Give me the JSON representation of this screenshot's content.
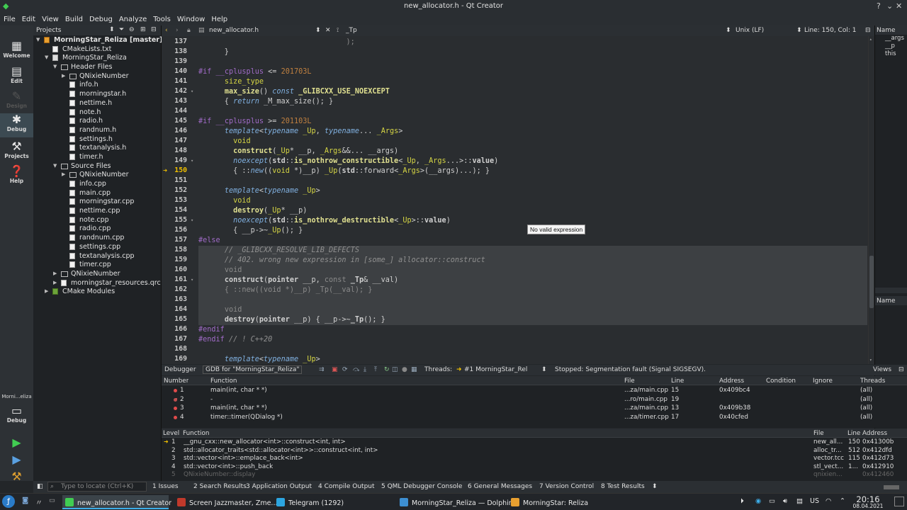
{
  "window": {
    "title": "new_allocator.h - Qt Creator"
  },
  "menu": [
    "File",
    "Edit",
    "View",
    "Build",
    "Debug",
    "Analyze",
    "Tools",
    "Window",
    "Help"
  ],
  "modes": [
    {
      "label": "Welcome",
      "icon": "grid-icon"
    },
    {
      "label": "Edit",
      "icon": "document-icon"
    },
    {
      "label": "Design",
      "icon": "pencil-icon",
      "disabled": true
    },
    {
      "label": "Debug",
      "icon": "bug-icon",
      "active": true
    },
    {
      "label": "Projects",
      "icon": "wrench-icon"
    },
    {
      "label": "Help",
      "icon": "help-icon"
    }
  ],
  "kit": {
    "project": "Morni...eliza",
    "mode": "Debug"
  },
  "projects": {
    "header": "Projects",
    "tree": [
      {
        "label": "MorningStar_Reliza [master]",
        "depth": 0,
        "arrow": "open",
        "icon": "project",
        "bold": true
      },
      {
        "label": "CMakeLists.txt",
        "depth": 1,
        "icon": "file"
      },
      {
        "label": "MorningStar_Reliza",
        "depth": 1,
        "arrow": "open",
        "icon": "target"
      },
      {
        "label": "Header Files",
        "depth": 2,
        "arrow": "open",
        "icon": "folder"
      },
      {
        "label": "QNixieNumber",
        "depth": 3,
        "arrow": "closed",
        "icon": "folder"
      },
      {
        "label": "info.h",
        "depth": 3,
        "icon": "file"
      },
      {
        "label": "morningstar.h",
        "depth": 3,
        "icon": "file"
      },
      {
        "label": "nettime.h",
        "depth": 3,
        "icon": "file"
      },
      {
        "label": "note.h",
        "depth": 3,
        "icon": "file"
      },
      {
        "label": "radio.h",
        "depth": 3,
        "icon": "file"
      },
      {
        "label": "randnum.h",
        "depth": 3,
        "icon": "file"
      },
      {
        "label": "settings.h",
        "depth": 3,
        "icon": "file"
      },
      {
        "label": "textanalysis.h",
        "depth": 3,
        "icon": "file"
      },
      {
        "label": "timer.h",
        "depth": 3,
        "icon": "file"
      },
      {
        "label": "Source Files",
        "depth": 2,
        "arrow": "open",
        "icon": "folder"
      },
      {
        "label": "QNixieNumber",
        "depth": 3,
        "arrow": "closed",
        "icon": "folder"
      },
      {
        "label": "info.cpp",
        "depth": 3,
        "icon": "file"
      },
      {
        "label": "main.cpp",
        "depth": 3,
        "icon": "file"
      },
      {
        "label": "morningstar.cpp",
        "depth": 3,
        "icon": "file"
      },
      {
        "label": "nettime.cpp",
        "depth": 3,
        "icon": "file"
      },
      {
        "label": "note.cpp",
        "depth": 3,
        "icon": "file"
      },
      {
        "label": "radio.cpp",
        "depth": 3,
        "icon": "file"
      },
      {
        "label": "randnum.cpp",
        "depth": 3,
        "icon": "file"
      },
      {
        "label": "settings.cpp",
        "depth": 3,
        "icon": "file"
      },
      {
        "label": "textanalysis.cpp",
        "depth": 3,
        "icon": "file"
      },
      {
        "label": "timer.cpp",
        "depth": 3,
        "icon": "file"
      },
      {
        "label": "QNixieNumber",
        "depth": 2,
        "arrow": "closed",
        "icon": "folder"
      },
      {
        "label": "morningstar_resources.qrc",
        "depth": 2,
        "arrow": "closed",
        "icon": "file"
      },
      {
        "label": "CMake Modules",
        "depth": 1,
        "arrow": "closed",
        "icon": "cmake"
      }
    ]
  },
  "editor": {
    "file": "new_allocator.h",
    "symbol": "_Tp",
    "line_ending": "Unix (LF)",
    "position": "Line: 150, Col: 1",
    "current_line": 150,
    "tooltip": "No valid expression",
    "lines": [
      {
        "n": 137,
        "h": "<span class='gr'>                                  );</span>"
      },
      {
        "n": 138,
        "h": "      }"
      },
      {
        "n": 139,
        "h": ""
      },
      {
        "n": 140,
        "h": "<span class='pp'>#if</span> <span class='pp'>__cplusplus</span> <= <span class='num'>201703L</span>"
      },
      {
        "n": 141,
        "h": "      <span class='ty'>size_type</span>"
      },
      {
        "n": 142,
        "h": "      <span class='fn'>max_size</span>() <span class='it'>const</span> <span class='fn'>_GLIBCXX_USE_NOEXCEPT</span>",
        "fold": 1
      },
      {
        "n": 143,
        "h": "      { <span class='it'>return</span> _M_max_size(); }"
      },
      {
        "n": 144,
        "h": ""
      },
      {
        "n": 145,
        "h": "<span class='pp'>#if</span> <span class='pp'>__cplusplus</span> >= <span class='num'>201103L</span>"
      },
      {
        "n": 146,
        "h": "      <span class='it'>template</span>&lt;<span class='it'>typename</span> <span class='ty'>_Up</span>, <span class='it'>typename</span>... <span class='ty'>_Args</span>&gt;"
      },
      {
        "n": 147,
        "h": "        <span class='ty'>void</span>"
      },
      {
        "n": 148,
        "h": "        <span class='fn'>construct</span>(<span class='ty'>_Up</span>* __p, <span class='ty'>_Args</span>&&... __args)"
      },
      {
        "n": 149,
        "h": "        <span class='it'>noexcept</span>(<span class='bo'>std</span>::<span class='fn'>is_nothrow_constructible</span>&lt;<span class='ty'>_Up</span>, <span class='ty'>_Args</span>...&gt;::<span class='bo'>value</span>)",
        "fold": 1
      },
      {
        "n": 150,
        "h": "        { ::<span class='it'>new</span>((<span class='ty'>void</span> *)__p) <span class='ty'>_Up</span>(<span class='bo'>std</span>::forward&lt;<span class='ty'>_Args</span>&gt;(__args)...); }"
      },
      {
        "n": 151,
        "h": ""
      },
      {
        "n": 152,
        "h": "      <span class='it'>template</span>&lt;<span class='it'>typename</span> <span class='ty'>_Up</span>&gt;"
      },
      {
        "n": 153,
        "h": "        <span class='ty'>void</span>"
      },
      {
        "n": 154,
        "h": "        <span class='fn'>destroy</span>(<span class='ty'>_Up</span>* __p)"
      },
      {
        "n": 155,
        "h": "        <span class='it'>noexcept</span>(<span class='bo'>std</span>::<span class='fn'>is_nothrow_destructible</span>&lt;<span class='ty'>_Up</span>&gt;::<span class='bo'>value</span>)",
        "fold": 1
      },
      {
        "n": 156,
        "h": "        { __p->~<span class='ty'>_Up</span>(); }"
      },
      {
        "n": 157,
        "h": "<span class='pp'>#else</span>"
      },
      {
        "n": 158,
        "h": "      <span class='cm'>// _GLIBCXX_RESOLVE_LIB_DEFECTS</span>",
        "hl": 1
      },
      {
        "n": 159,
        "h": "      <span class='cm'>// 402. wrong new expression in [some_] allocator::construct</span>",
        "hl": 1
      },
      {
        "n": 160,
        "h": "      <span class='gr'>void</span>",
        "hl": 1
      },
      {
        "n": 161,
        "h": "      <span class='bo'>construct</span>(<span class='bo'>pointer</span> __p, <span class='gr'>const</span> <span class='bo'>_Tp</span>& __val)",
        "hl": 1,
        "fold": 1
      },
      {
        "n": 162,
        "h": "      <span class='gr'>{ ::new((void *)__p) _Tp(__val); }</span>",
        "hl": 1
      },
      {
        "n": 163,
        "h": "",
        "hl": 1
      },
      {
        "n": 164,
        "h": "      <span class='gr'>void</span>",
        "hl": 1
      },
      {
        "n": 165,
        "h": "      <span class='bo'>destroy</span>(<span class='bo'>pointer</span> __p) { __p->~<span class='bo'>_Tp</span>(); }",
        "hl": 1
      },
      {
        "n": 166,
        "h": "<span class='pp'>#endif</span>"
      },
      {
        "n": 167,
        "h": "<span class='pp'>#endif</span> <span class='cm'>// ! C++20</span>"
      },
      {
        "n": 168,
        "h": ""
      },
      {
        "n": 169,
        "h": "      <span class='it'>template</span>&lt;<span class='it'>typename</span> <span class='ty'>_Up</span>&gt;"
      }
    ]
  },
  "locals": {
    "header": "Name",
    "items": [
      "__args",
      "__p",
      "this"
    ],
    "header2": "Name"
  },
  "debugger": {
    "label": "Debugger",
    "engine": "GDB for \"MorningStar_Reliza\"",
    "threads_label": "Threads:",
    "thread": "#1 MorningStar_Rel",
    "status": "Stopped: Segmentation fault (Signal SIGSEGV).",
    "views": "Views"
  },
  "breakpoints": {
    "columns": [
      "Number",
      "Function",
      "File",
      "Line",
      "Address",
      "Condition",
      "Ignore",
      "Threads"
    ],
    "rows": [
      {
        "num": "1",
        "func": "main(int, char * *)",
        "file": "...za/main.cpp",
        "line": "15",
        "addr": "0x409bc4",
        "thr": "(all)",
        "kind": "on"
      },
      {
        "num": "2",
        "func": "-",
        "file": "...ro/main.cpp",
        "line": "19",
        "addr": "",
        "thr": "(all)",
        "kind": "pending"
      },
      {
        "num": "3",
        "func": "main(int, char * *)",
        "file": "...za/main.cpp",
        "line": "13",
        "addr": "0x409b38",
        "thr": "(all)",
        "kind": "on"
      },
      {
        "num": "4",
        "func": "timer::timer(QDialog *)",
        "file": "...za/timer.cpp",
        "line": "17",
        "addr": "0x40cfed",
        "thr": "(all)",
        "kind": "on"
      }
    ]
  },
  "stack": {
    "columns": [
      "Level",
      "Function",
      "File",
      "Line",
      "Address"
    ],
    "rows": [
      {
        "lvl": "1",
        "func": "__gnu_cxx::new_allocator<int>::construct<int, int>",
        "file": "new_all...",
        "line": "150",
        "addr": "0x41300b",
        "cur": true
      },
      {
        "lvl": "2",
        "func": "std::allocator_traits<std::allocator<int>>::construct<int, int>",
        "file": "alloc_tr...",
        "line": "512",
        "addr": "0x412dfd"
      },
      {
        "lvl": "3",
        "func": "std::vector<int>::emplace_back<int>",
        "file": "vector.tcc",
        "line": "115",
        "addr": "0x412d73"
      },
      {
        "lvl": "4",
        "func": "std::vector<int>::push_back",
        "file": "stl_vect...",
        "line": "1...",
        "addr": "0x412910"
      },
      {
        "lvl": "5",
        "func": "QNixieNumber::display",
        "file": "qnixien...",
        "line": "",
        "addr": "0x412460",
        "dim": true
      }
    ]
  },
  "statusbar": {
    "locate_placeholder": "Type to locate (Ctrl+K)",
    "panes": [
      "1 Issues",
      "2 Search Results",
      "3 Application Output",
      "4 Compile Output",
      "5 QML Debugger Console",
      "6 General Messages",
      "7 Version Control",
      "8 Test Results"
    ]
  },
  "taskbar": {
    "tasks": [
      {
        "label": "new_allocator.h - Qt Creator",
        "active": true,
        "color": "#41cd52"
      },
      {
        "label": "Screen Jazzmaster, Zme...",
        "color": "#c0392b"
      },
      {
        "label": "Telegram (1292)",
        "color": "#2ca5e0"
      },
      {
        "label": "MorningStar_Reliza — Dolphin",
        "color": "#3d8fd1"
      },
      {
        "label": "MorningStar: Reliza",
        "color": "#e8a030"
      }
    ],
    "keyboard": "US",
    "time": "20:16",
    "date": "08.04.2021"
  },
  "colors": {
    "accent": "#3daee9",
    "breakpoint": "#e24b4b",
    "current_line_arrow": "#f0c000"
  }
}
